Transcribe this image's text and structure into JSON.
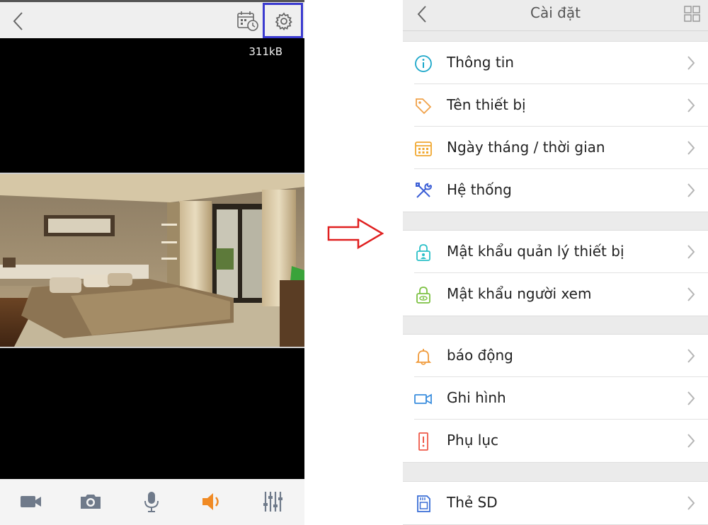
{
  "live_view": {
    "bitrate": "311kB",
    "icons": {
      "back": "chevron-left-icon",
      "schedule": "calendar-clock-icon",
      "settings": "gear-icon",
      "record": "video-camera-icon",
      "snapshot": "camera-icon",
      "talk": "microphone-icon",
      "audio": "speaker-icon",
      "adjust": "sliders-icon"
    },
    "colors": {
      "highlight_border": "#3b3bd0",
      "audio_active": "#f08a24"
    }
  },
  "settings": {
    "title": "Cài đặt",
    "groups": [
      {
        "items": [
          {
            "label": "Thông tin",
            "icon": "info-icon",
            "color": "#1aa6c9"
          },
          {
            "label": "Tên thiết bị",
            "icon": "tag-icon",
            "color": "#f0a24a"
          },
          {
            "label": "Ngày tháng / thời gian",
            "icon": "calendar-icon",
            "color": "#f0a830"
          },
          {
            "label": "Hệ thống",
            "icon": "tools-icon",
            "color": "#3c5fd6"
          }
        ]
      },
      {
        "items": [
          {
            "label": "Mật khẩu quản lý thiết bị",
            "icon": "lock-admin-icon",
            "color": "#2bc0c8"
          },
          {
            "label": "Mật khẩu người xem",
            "icon": "lock-viewer-icon",
            "color": "#7cc142"
          }
        ]
      },
      {
        "items": [
          {
            "label": "báo động",
            "icon": "bell-icon",
            "color": "#f09a3a"
          },
          {
            "label": "Ghi hình",
            "icon": "video-icon",
            "color": "#3b8ede"
          },
          {
            "label": "Phụ lục",
            "icon": "appendix-icon",
            "color": "#ee5a4a"
          }
        ]
      },
      {
        "items": [
          {
            "label": "Thẻ SD",
            "icon": "sd-card-icon",
            "color": "#3b6fd6"
          }
        ]
      }
    ]
  }
}
